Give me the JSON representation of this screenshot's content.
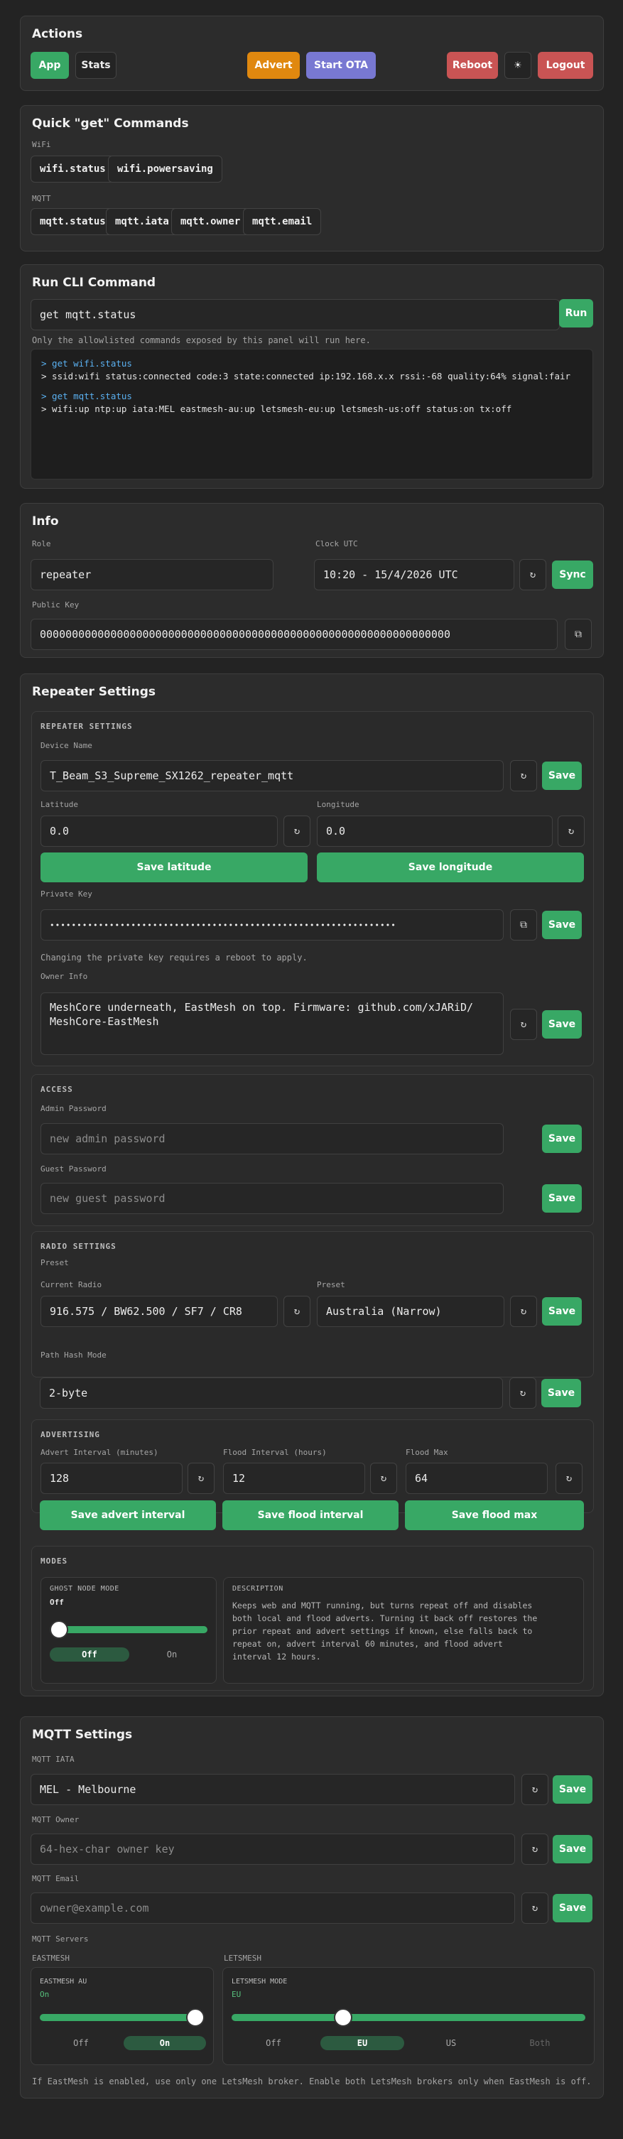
{
  "actions": {
    "title": "Actions",
    "app": "App",
    "stats": "Stats",
    "advert": "Advert",
    "ota": "Start OTA",
    "reboot": "Reboot",
    "theme": "☀",
    "logout": "Logout"
  },
  "quick": {
    "title": "Quick \"get\" Commands",
    "wifi_label": "WiFi",
    "wifi": [
      "wifi.status",
      "wifi.powersaving"
    ],
    "mqtt_label": "MQTT",
    "mqtt": [
      "mqtt.status",
      "mqtt.iata",
      "mqtt.owner",
      "mqtt.email"
    ]
  },
  "cli": {
    "title": "Run CLI Command",
    "value": "get mqtt.status",
    "run": "Run",
    "hint": "Only the allowlisted commands exposed by this panel will run here.",
    "log": [
      {
        "cmd": "> get wifi.status",
        "out": "> ssid:wifi status:connected code:3 state:connected ip:192.168.x.x rssi:-68 quality:64% signal:fair"
      },
      {
        "cmd": "> get mqtt.status",
        "out": "> wifi:up ntp:up iata:MEL eastmesh-au:up letsmesh-eu:up letsmesh-us:off status:on tx:off"
      }
    ]
  },
  "info": {
    "title": "Info",
    "role_label": "Role",
    "role": "repeater",
    "clock_label": "Clock UTC",
    "clock": "10:20 - 15/4/2026 UTC",
    "sync": "Sync",
    "pub_label": "Public Key",
    "pub": "0000000000000000000000000000000000000000000000000000000000000000"
  },
  "repeater": {
    "title": "Repeater Settings",
    "section": "REPEATER SETTINGS",
    "name_label": "Device Name",
    "name": "T_Beam_S3_Supreme_SX1262_repeater_mqtt",
    "save": "Save",
    "lat_label": "Latitude",
    "lat": "0.0",
    "lon_label": "Longitude",
    "lon": "0.0",
    "save_lat": "Save latitude",
    "save_lon": "Save longitude",
    "pk_label": "Private Key",
    "pk": "••••••••••••••••••••••••••••••••••••••••••••••••••••••••••••••••",
    "pk_note": "Changing the private key requires a reboot to apply.",
    "owner_label": "Owner Info",
    "owner": "MeshCore underneath, EastMesh on top. Firmware: github.com/xJARiD/\nMeshCore-EastMesh"
  },
  "access": {
    "section": "ACCESS",
    "admin_label": "Admin Password",
    "admin_ph": "new admin password",
    "guest_label": "Guest Password",
    "guest_ph": "new guest password",
    "save": "Save"
  },
  "radio": {
    "section": "RADIO SETTINGS",
    "preset_top": "Preset",
    "current_label": "Current Radio",
    "current": "916.575 / BW62.500 / SF7 / CR8",
    "preset_label": "Preset",
    "preset": "Australia (Narrow)",
    "path_label": "Path Hash Mode",
    "path": "2-byte",
    "save": "Save"
  },
  "advertising": {
    "section": "ADVERTISING",
    "adv_label": "Advert Interval (minutes)",
    "adv": "128",
    "flood_label": "Flood Interval (hours)",
    "flood": "12",
    "fmax_label": "Flood Max",
    "fmax": "64",
    "save_adv": "Save advert interval",
    "save_flood": "Save flood interval",
    "save_fmax": "Save flood max"
  },
  "modes": {
    "section": "MODES",
    "ghost_title": "GHOST NODE MODE",
    "ghost_state": "Off",
    "opt_off": "Off",
    "opt_on": "On",
    "desc_title": "DESCRIPTION",
    "desc": "Keeps web and MQTT running, but turns repeat off and disables both local and flood adverts. Turning it back off restores the prior repeat and advert settings if known, else falls back to repeat on, advert interval 60 minutes, and flood advert interval 12 hours."
  },
  "mqtt": {
    "title": "MQTT Settings",
    "iata_label": "MQTT IATA",
    "iata": "MEL - Melbourne",
    "owner_label": "MQTT Owner",
    "owner_ph": "64-hex-char owner key",
    "email_label": "MQTT Email",
    "email_ph": "owner@example.com",
    "save": "Save",
    "servers_label": "MQTT Servers",
    "east_label": "EASTMESH",
    "east_card": "EASTMESH AU",
    "east_state": "On",
    "lets_label": "LETSMESH",
    "lets_card": "LETSMESH MODE",
    "lets_state": "EU",
    "off": "Off",
    "on": "On",
    "eu": "EU",
    "us": "US",
    "both": "Both",
    "note": "If EastMesh is enabled, use only one LetsMesh broker. Enable both LetsMesh brokers only when EastMesh is off."
  },
  "colors": {
    "accent": "#38a865",
    "orange": "#e0880f",
    "purple": "#7878d2",
    "red": "#c95454",
    "cmd": "#5ab0f0"
  },
  "icons": {
    "refresh": "↻",
    "copy": "⧉",
    "theme": "☀"
  }
}
